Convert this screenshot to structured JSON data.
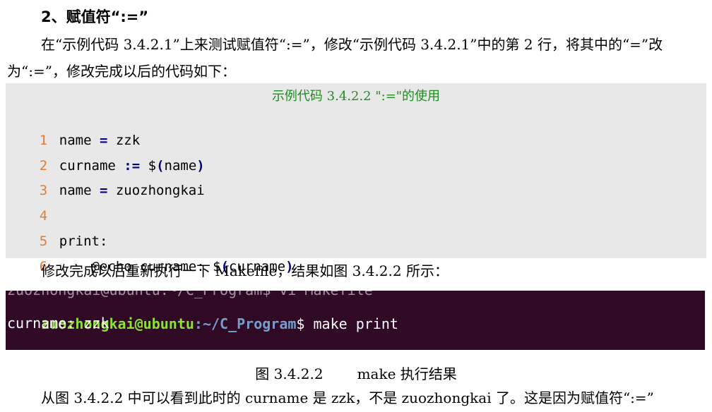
{
  "heading": "2、赋值符“:=”",
  "paragraph1": "在“示例代码 3.4.2.1”上来测试赋值符“:=”，修改“示例代码 3.4.2.1”中的第 2 行，将其中的“=”改为“:=”，修改完成以后的代码如下：",
  "code": {
    "title": "示例代码 3.4.2.2   \":=\"的使用",
    "lines": [
      {
        "num": "1",
        "pre": "name ",
        "op": "=",
        "post": " zzk"
      },
      {
        "num": "2",
        "pre": "curname ",
        "op": ":=",
        "post": " $",
        "paren_open": "(",
        "inner": "name",
        "paren_close": ")"
      },
      {
        "num": "3",
        "pre": "name ",
        "op": "=",
        "post": " zuozhongkai"
      },
      {
        "num": "4",
        "pre": ""
      },
      {
        "num": "5",
        "pre": "print:"
      },
      {
        "num": "6",
        "pre": "    @echo curname: $",
        "paren_open": "(",
        "inner": "curname",
        "paren_close": ")"
      }
    ]
  },
  "paragraph2": "修改完成以后重新执行一下 Makefile，结果如图 3.4.2.2 所示：",
  "terminal": {
    "ghost_line": "zuozhongkai@ubuntu:~/C_Program$ vi Makefile",
    "user": "zuozhongkai@ubuntu",
    "path": ":~/C_Program",
    "prompt_end": "$",
    "command": " make print",
    "output": "curname: zzk"
  },
  "caption": {
    "label": "图 3.4.2.2",
    "text": "make 执行结果"
  },
  "paragraph3": "从图 3.4.2.2 中可以看到此时的 curname 是 zzk，不是 zuozhongkai 了。这是因为赋值符“:=”"
}
